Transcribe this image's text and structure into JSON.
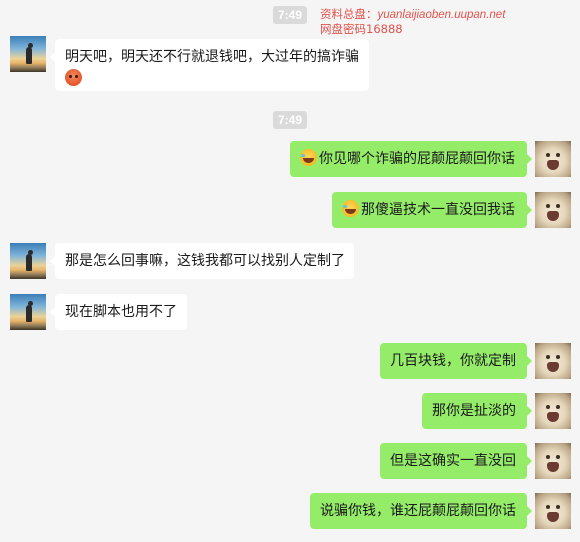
{
  "watermark": {
    "line1_prefix": "资料总盘：",
    "line1_url": "yuanlaijiaoben.uupan.net",
    "line2": "网盘密码16888"
  },
  "timestamps": [
    "7:49",
    "7:49"
  ],
  "messages": [
    {
      "side": "left",
      "avatar": "sunset-silhouette-avatar",
      "text": "明天吧，明天还不行就退钱吧，大过年的搞诈骗",
      "emoji": "angry-face-emoji"
    },
    {
      "side": "right",
      "avatar": "dog-avatar",
      "emoji": "laughing-face-emoji",
      "text": "你见哪个诈骗的屁颠屁颠回你话"
    },
    {
      "side": "right",
      "avatar": "dog-avatar",
      "emoji": "laughing-face-emoji",
      "text": "那傻逼技术一直没回我话"
    },
    {
      "side": "left",
      "avatar": "sunset-silhouette-avatar",
      "text": "那是怎么回事嘛，这钱我都可以找别人定制了"
    },
    {
      "side": "left",
      "avatar": "sunset-silhouette-avatar",
      "text": "现在脚本也用不了"
    },
    {
      "side": "right",
      "avatar": "dog-avatar",
      "text": "几百块钱，你就定制"
    },
    {
      "side": "right",
      "avatar": "dog-avatar",
      "text": "那你是扯淡的"
    },
    {
      "side": "right",
      "avatar": "dog-avatar",
      "text": "但是这确实一直没回"
    },
    {
      "side": "right",
      "avatar": "dog-avatar",
      "text": "说骗你钱，谁还屁颠屁颠回你话"
    }
  ],
  "colors": {
    "background": "#f5f5f5",
    "incoming_bubble": "#ffffff",
    "outgoing_bubble": "#95ec69",
    "watermark": "#e0524c",
    "timestamp_bg": "#dadada"
  }
}
